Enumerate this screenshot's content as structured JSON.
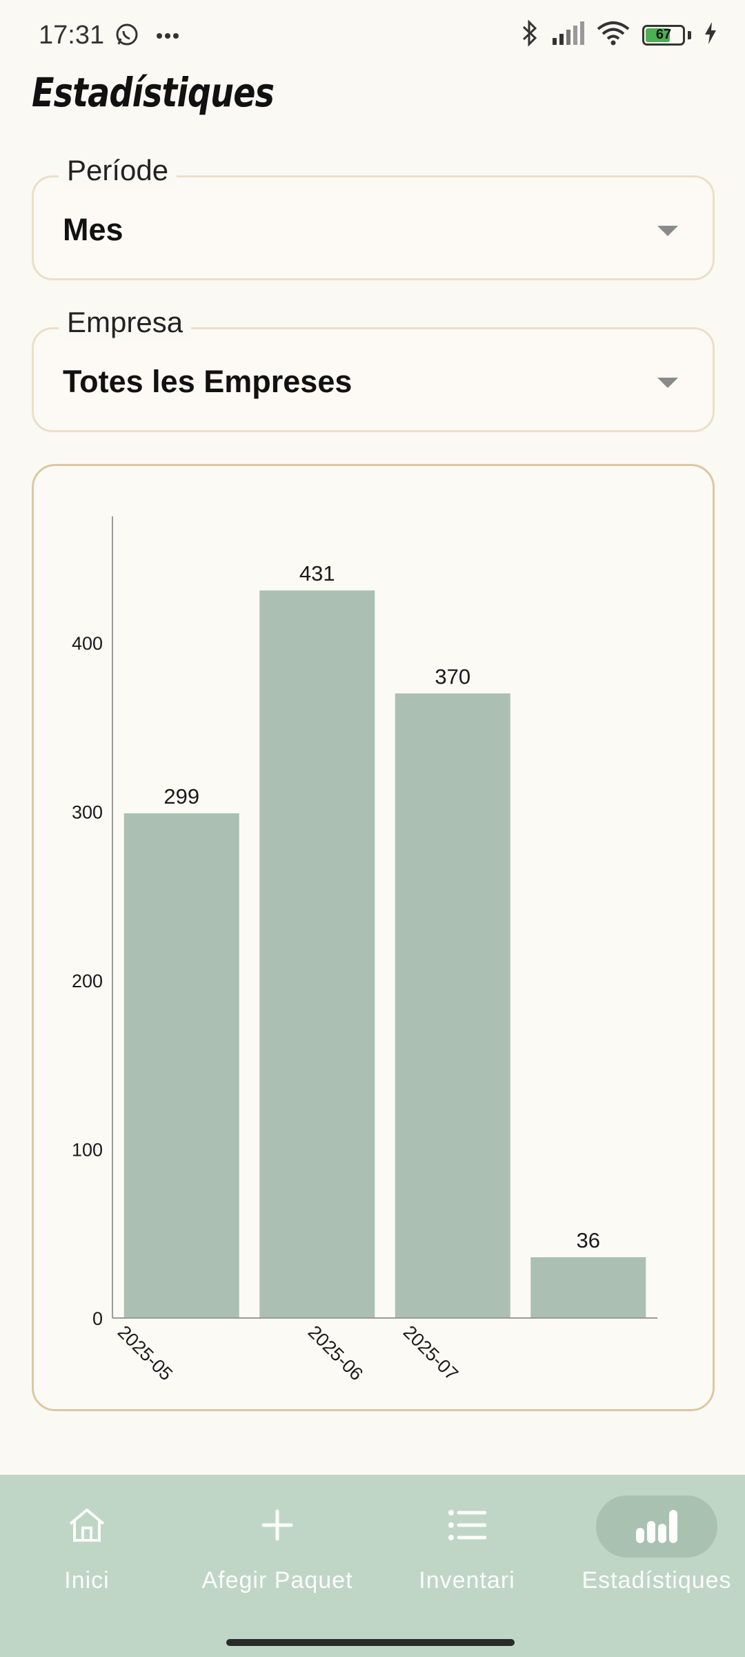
{
  "status_bar": {
    "time": "17:31",
    "battery": "67",
    "battery_level": 0.67,
    "icons": [
      "whatsapp-icon",
      "more-icon",
      "bluetooth-icon",
      "signal-icon",
      "wifi-icon",
      "battery-icon",
      "charging-icon"
    ]
  },
  "page": {
    "title": "Estadístiques"
  },
  "period_field": {
    "label": "Període",
    "value": "Mes"
  },
  "company_field": {
    "label": "Empresa",
    "value": "Totes les Empreses"
  },
  "chart_data": {
    "type": "bar",
    "categories": [
      "2025-05",
      "2025-06",
      "2025-07",
      ""
    ],
    "values": [
      299,
      431,
      370,
      36
    ],
    "data_labels": [
      "299",
      "431",
      "370",
      "36"
    ],
    "x_tick_labels": [
      "2025-05",
      "2025-06",
      "2025-07"
    ],
    "y_ticks": [
      0,
      100,
      200,
      300,
      400
    ],
    "ylim": [
      0,
      470
    ],
    "title": "",
    "xlabel": "",
    "ylabel": "",
    "bar_color": "#abc0b3",
    "grid": false
  },
  "nav": {
    "items": [
      {
        "label": "Inici",
        "icon": "home-icon"
      },
      {
        "label": "Afegir Paquet",
        "icon": "plus-icon"
      },
      {
        "label": "Inventari",
        "icon": "list-icon"
      },
      {
        "label": "Estadístiques",
        "icon": "bar-chart-icon"
      }
    ],
    "active_index": 3,
    "background": "#bfd6c7"
  }
}
